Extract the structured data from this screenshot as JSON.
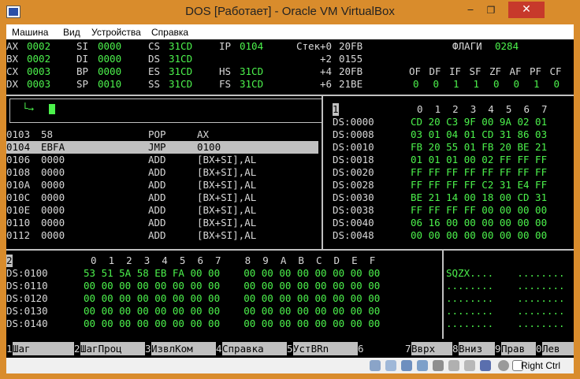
{
  "window": {
    "title": "DOS [Работает] - Oracle VM VirtualBox",
    "min": "‒",
    "max": "❐",
    "close": "✕"
  },
  "menu": [
    "Машина",
    "Вид",
    "Устройства",
    "Справка"
  ],
  "registers": {
    "rows": [
      {
        "a": "AX",
        "av": "0002",
        "b": "SI",
        "bv": "0000",
        "c": "CS",
        "cv": "31CD",
        "d": "IP",
        "dv": "0104"
      },
      {
        "a": "BX",
        "av": "0002",
        "b": "DI",
        "bv": "0000",
        "c": "DS",
        "cv": "31CD",
        "d": "",
        "dv": ""
      },
      {
        "a": "CX",
        "av": "0003",
        "b": "BP",
        "bv": "0000",
        "c": "ES",
        "cv": "31CD",
        "d": "HS",
        "dv": "31CD"
      },
      {
        "a": "DX",
        "av": "0003",
        "b": "SP",
        "bv": "0010",
        "c": "SS",
        "cv": "31CD",
        "d": "FS",
        "dv": "31CD"
      }
    ],
    "stack_label": "Стек",
    "stack": [
      {
        "off": "+0",
        "val": "20FB"
      },
      {
        "off": "+2",
        "val": "0155"
      },
      {
        "off": "+4",
        "val": "20FB"
      },
      {
        "off": "+6",
        "val": "21BE"
      }
    ],
    "flags_label": "ФЛАГИ",
    "flags_value": "0284",
    "flag_names": [
      "OF",
      "DF",
      "IF",
      "SF",
      "ZF",
      "AF",
      "PF",
      "CF"
    ],
    "flag_values": [
      "0",
      "0",
      "1",
      "1",
      "0",
      "0",
      "1",
      "0"
    ]
  },
  "command_prompt": "└→",
  "disasm": [
    {
      "addr": "0103",
      "bytes": "58",
      "op": "POP",
      "arg": "AX"
    },
    {
      "addr": "0104",
      "bytes": "EBFA",
      "op": "JMP",
      "arg": "0100"
    },
    {
      "addr": "0106",
      "bytes": "0000",
      "op": "ADD",
      "arg": "[BX+SI],AL"
    },
    {
      "addr": "0108",
      "bytes": "0000",
      "op": "ADD",
      "arg": "[BX+SI],AL"
    },
    {
      "addr": "010A",
      "bytes": "0000",
      "op": "ADD",
      "arg": "[BX+SI],AL"
    },
    {
      "addr": "010C",
      "bytes": "0000",
      "op": "ADD",
      "arg": "[BX+SI],AL"
    },
    {
      "addr": "010E",
      "bytes": "0000",
      "op": "ADD",
      "arg": "[BX+SI],AL"
    },
    {
      "addr": "0110",
      "bytes": "0000",
      "op": "ADD",
      "arg": "[BX+SI],AL"
    },
    {
      "addr": "0112",
      "bytes": "0000",
      "op": "ADD",
      "arg": "[BX+SI],AL"
    }
  ],
  "dump1": {
    "num": "1",
    "header": "0  1  2  3  4  5  6  7",
    "rows": [
      {
        "addr": "DS:0000",
        "bytes": "CD 20 C3 9F 00 9A 02 01"
      },
      {
        "addr": "DS:0008",
        "bytes": "03 01 04 01 CD 31 86 03"
      },
      {
        "addr": "DS:0010",
        "bytes": "FB 20 55 01 FB 20 BE 21"
      },
      {
        "addr": "DS:0018",
        "bytes": "01 01 01 00 02 FF FF FF"
      },
      {
        "addr": "DS:0020",
        "bytes": "FF FF FF FF FF FF FF FF"
      },
      {
        "addr": "DS:0028",
        "bytes": "FF FF FF FF C2 31 E4 FF"
      },
      {
        "addr": "DS:0030",
        "bytes": "BE 21 14 00 18 00 CD 31"
      },
      {
        "addr": "DS:0038",
        "bytes": "FF FF FF FF 00 00 00 00"
      },
      {
        "addr": "DS:0040",
        "bytes": "06 16 00 00 00 00 00 00"
      },
      {
        "addr": "DS:0048",
        "bytes": "00 00 00 00 00 00 00 00"
      }
    ]
  },
  "dump2": {
    "num": "2",
    "header": "0  1  2  3  4  5  6  7    8  9  A  B  C  D  E  F",
    "rows": [
      {
        "addr": "DS:0100",
        "bytes": "53 51 5A 58 EB FA 00 00    00 00 00 00 00 00 00 00",
        "ascii": "SQZX....    ........"
      },
      {
        "addr": "DS:0110",
        "bytes": "00 00 00 00 00 00 00 00    00 00 00 00 00 00 00 00",
        "ascii": "........    ........"
      },
      {
        "addr": "DS:0120",
        "bytes": "00 00 00 00 00 00 00 00    00 00 00 00 00 00 00 00",
        "ascii": "........    ........"
      },
      {
        "addr": "DS:0130",
        "bytes": "00 00 00 00 00 00 00 00    00 00 00 00 00 00 00 00",
        "ascii": "........    ........"
      },
      {
        "addr": "DS:0140",
        "bytes": "00 00 00 00 00 00 00 00    00 00 00 00 00 00 00 00",
        "ascii": "........    ........"
      }
    ]
  },
  "fkeys": [
    {
      "n": "1",
      "label": "Шаг"
    },
    {
      "n": "2",
      "label": "ШагПроц"
    },
    {
      "n": "3",
      "label": "ИзвлКом"
    },
    {
      "n": "4",
      "label": "Справка"
    },
    {
      "n": "5",
      "label": "УстВRn"
    },
    {
      "n": "6",
      "label": ""
    },
    {
      "n": "7",
      "label": "Вврх"
    },
    {
      "n": "8",
      "label": "Вниз"
    },
    {
      "n": "9",
      "label": "Прав"
    },
    {
      "n": "0",
      "label": "Лев"
    }
  ],
  "status": {
    "host_key": "Right Ctrl"
  },
  "colors": {
    "screen_bg": "#000000",
    "text_white": "#d8d8d8",
    "text_green": "#4cf24c",
    "highlight": "#c0c0c0",
    "window_frame": "#d98c2c",
    "close_button": "#c7392b"
  }
}
